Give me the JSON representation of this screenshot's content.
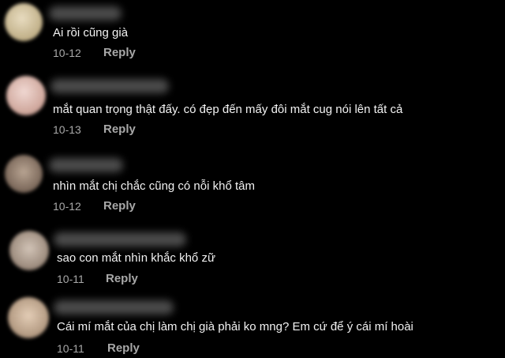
{
  "comments": [
    {
      "text": "Ai rồi cũng già",
      "date": "10-12",
      "reply_label": "Reply",
      "avatar_color": "#d9c9a6"
    },
    {
      "text": "mắt quan trọng thật đấy. có đẹp đến mấy đôi mắt cug nói lên tất cả",
      "date": "10-13",
      "reply_label": "Reply",
      "avatar_color": "#d7b9b0"
    },
    {
      "text": "nhìn mắt chị chắc cũng có nỗi khổ tâm",
      "date": "10-12",
      "reply_label": "Reply",
      "avatar_color": "#9c8778"
    },
    {
      "text": "sao con mắt nhìn khắc khổ zữ",
      "date": "10-11",
      "reply_label": "Reply",
      "avatar_color": "#b3a497"
    },
    {
      "text": "Cái mí mắt của chị làm chị già phải ko mng? Em cứ để ý cái mí hoài",
      "date": "10-11",
      "reply_label": "Reply",
      "avatar_color": "#c8b29c"
    }
  ]
}
